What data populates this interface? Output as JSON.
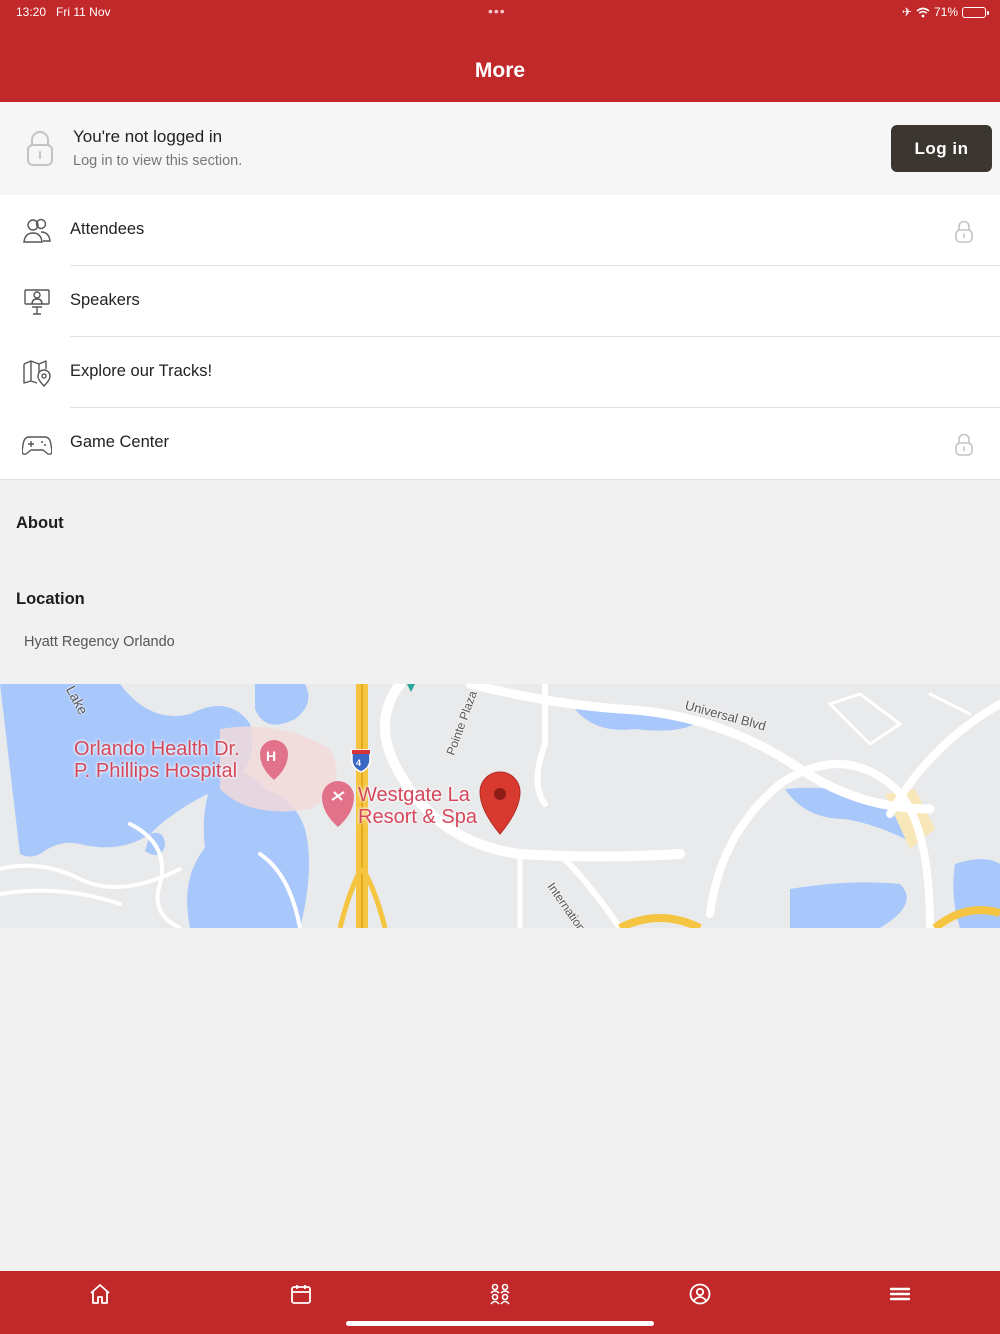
{
  "status_bar": {
    "time": "13:20",
    "date": "Fri 11 Nov",
    "battery": "71%",
    "battery_level": 0.71
  },
  "header": {
    "title": "More"
  },
  "login_banner": {
    "title": "You're not logged in",
    "subtitle": "Log in to view this section.",
    "button_label": "Log in"
  },
  "menu": {
    "items": [
      {
        "label": "Attendees",
        "icon": "attendees-icon",
        "locked": true
      },
      {
        "label": "Speakers",
        "icon": "speaker-icon",
        "locked": false
      },
      {
        "label": "Explore our Tracks!",
        "icon": "map-pin-icon",
        "locked": false
      },
      {
        "label": "Game Center",
        "icon": "gamepad-icon",
        "locked": true
      }
    ]
  },
  "about": {
    "heading": "About"
  },
  "location": {
    "heading": "Location",
    "name": "Hyatt Regency Orlando",
    "map": {
      "labels": {
        "hospital_line1": "Orlando Health Dr.",
        "hospital_line2": "P. Phillips Hospital",
        "resort_line1": "Westgate La",
        "resort_line2": "Resort & Spa",
        "lake": "Lake",
        "universal": "Universal Blvd",
        "pointe": "Pointe Plaza",
        "international": "International D",
        "interstate": "4"
      }
    }
  },
  "tabbar": {
    "tabs": [
      {
        "name": "home-icon"
      },
      {
        "name": "calendar-icon"
      },
      {
        "name": "people-icon"
      },
      {
        "name": "profile-icon"
      },
      {
        "name": "menu-icon",
        "active": true
      }
    ]
  },
  "colors": {
    "brand": "#c1282a",
    "button_dark": "#3c3631",
    "water": "#a8c7fa",
    "highway": "#f5c542"
  }
}
